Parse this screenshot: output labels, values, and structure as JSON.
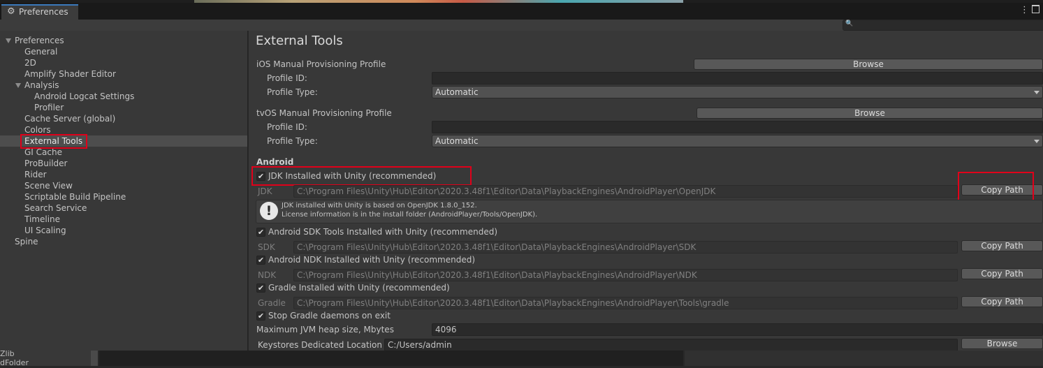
{
  "window": {
    "tab_title": "Preferences"
  },
  "tree": {
    "root": "Preferences",
    "items": [
      "General",
      "2D",
      "Amplify Shader Editor",
      "Analysis",
      "Android Logcat Settings",
      "Profiler",
      "Cache Server (global)",
      "Colors",
      "External Tools",
      "GI Cache",
      "ProBuilder",
      "Rider",
      "Scene View",
      "Scriptable Build Pipeline",
      "Search Service",
      "Timeline",
      "UI Scaling",
      "Spine"
    ],
    "selected": "External Tools"
  },
  "main": {
    "title": "External Tools",
    "ios": {
      "header": "iOS Manual Provisioning Profile",
      "browse_label": "Browse",
      "profile_id_label": "Profile ID:",
      "profile_id_value": "",
      "profile_type_label": "Profile Type:",
      "profile_type_value": "Automatic"
    },
    "tvos": {
      "header": "tvOS Manual Provisioning Profile",
      "browse_label": "Browse",
      "profile_id_label": "Profile ID:",
      "profile_id_value": "",
      "profile_type_label": "Profile Type:",
      "profile_type_value": "Automatic"
    },
    "android": {
      "header": "Android",
      "jdk_toggle": "JDK Installed with Unity (recommended)",
      "jdk_label": "JDK",
      "jdk_path": "C:\\Program Files\\Unity\\Hub\\Editor\\2020.3.48f1\\Editor\\Data\\PlaybackEngines\\AndroidPlayer\\OpenJDK",
      "copy_path": "Copy Path",
      "help_line1": "JDK installed with Unity is based on OpenJDK 1.8.0_152.",
      "help_line2": "License information is in the install folder (AndroidPlayer/Tools/OpenJDK).",
      "sdk_toggle": "Android SDK Tools Installed with Unity (recommended)",
      "sdk_label": "SDK",
      "sdk_path": "C:\\Program Files\\Unity\\Hub\\Editor\\2020.3.48f1\\Editor\\Data\\PlaybackEngines\\AndroidPlayer\\SDK",
      "ndk_toggle": "Android NDK Installed with Unity (recommended)",
      "ndk_label": "NDK",
      "ndk_path": "C:\\Program Files\\Unity\\Hub\\Editor\\2020.3.48f1\\Editor\\Data\\PlaybackEngines\\AndroidPlayer\\NDK",
      "gradle_toggle": "Gradle Installed with Unity (recommended)",
      "gradle_label": "Gradle",
      "gradle_path": "C:\\Program Files\\Unity\\Hub\\Editor\\2020.3.48f1\\Editor\\Data\\PlaybackEngines\\AndroidPlayer\\Tools\\gradle",
      "stop_gradle": "Stop Gradle daemons on exit",
      "jvm_label": "Maximum JVM heap size, Mbytes",
      "jvm_value": "4096",
      "keystore_label": "Keystores Dedicated Location",
      "keystore_value": "C:/Users/admin",
      "keystore_browse": "Browse"
    }
  },
  "background_fragments": {
    "zlib": "Zlib",
    "folder": "dFolder"
  },
  "colors": {
    "highlight_red": "#e0001a",
    "tab_accent": "#3a79bb",
    "panel": "#383838"
  }
}
